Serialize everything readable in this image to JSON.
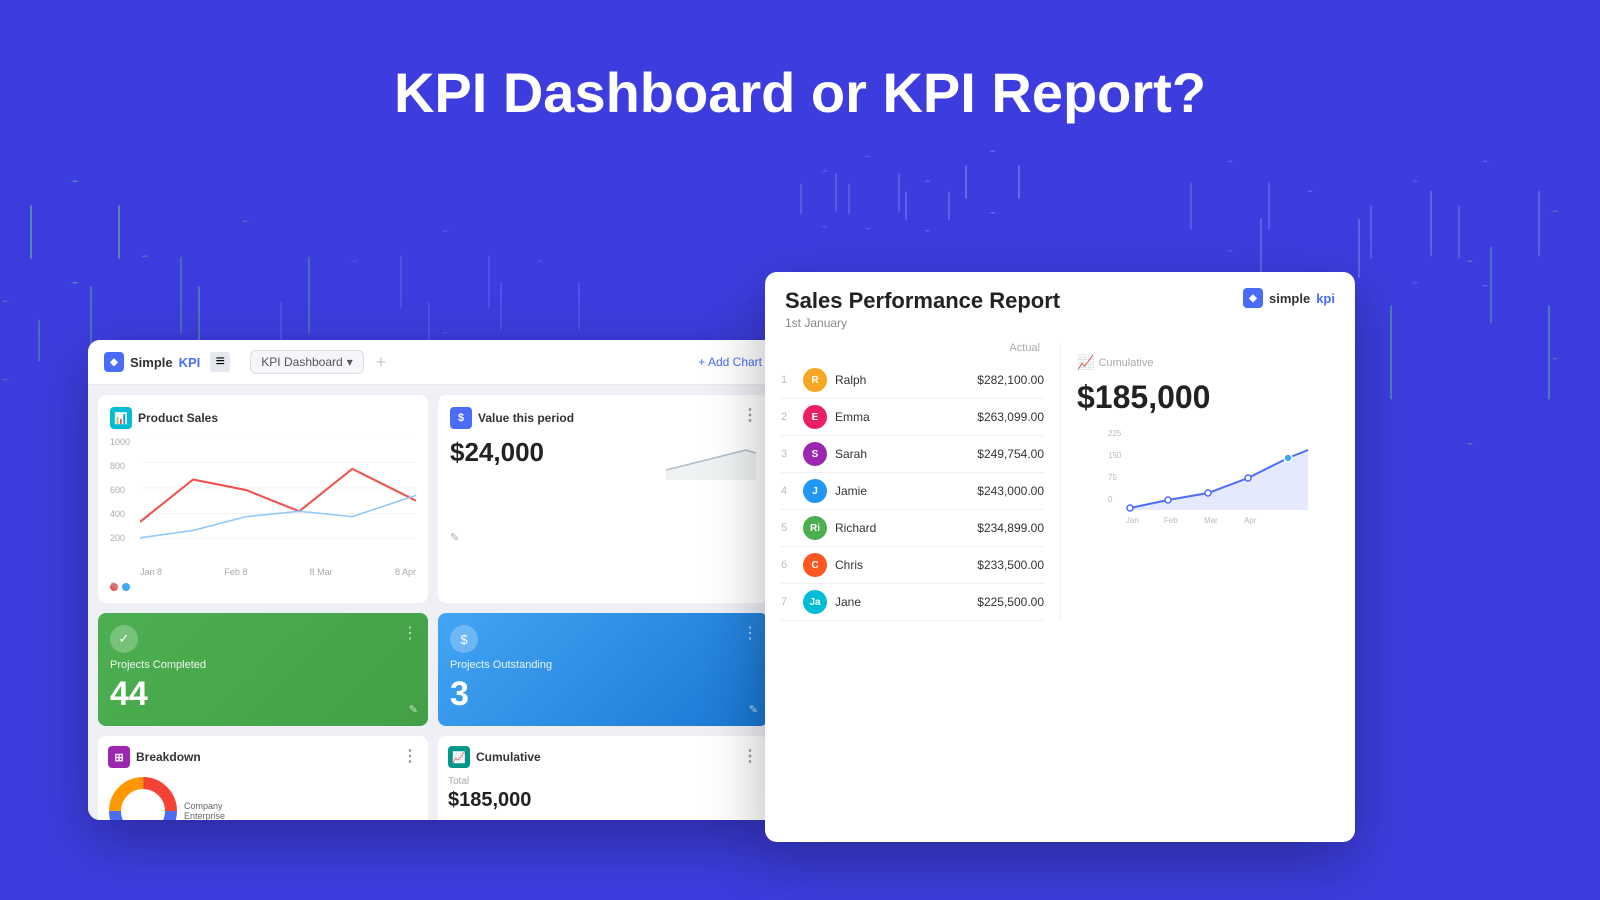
{
  "page": {
    "title": "KPI Dashboard or KPI Report?",
    "bg_color": "#3d3ddf"
  },
  "dashboard": {
    "logo_text": "Simple",
    "logo_blue": "KPI",
    "selector_label": "KPI Dashboard",
    "add_chart_label": "+ Add Chart",
    "product_sales": {
      "title": "Product Sales",
      "y_labels": [
        "1000",
        "800",
        "600",
        "400",
        "200",
        ""
      ],
      "x_labels": [
        "Jan 8",
        "Feb 8",
        "8 Mar",
        "8 Apr"
      ],
      "edit_icon": "✎"
    },
    "value_period": {
      "label": "Value this period",
      "value": "$24,000",
      "edit_icon": "✎"
    },
    "projects_completed": {
      "label": "Projects Completed",
      "value": "44",
      "icon": "✓"
    },
    "projects_outstanding": {
      "label": "Projects Outstanding",
      "value": "3",
      "icon": "$"
    },
    "breakdown": {
      "title": "Breakdown",
      "company_label": "Company",
      "enterprise_label": "Enterprise"
    },
    "cumulative": {
      "title": "Cumulative",
      "total_label": "Total",
      "total_value": "$185,000"
    }
  },
  "report": {
    "logo_text": "simple",
    "logo_blue": "kpi",
    "title": "Sales Performance Report",
    "date": "1st January",
    "actual_label": "Actual",
    "cumulative_label": "Cumulative",
    "cumulative_value": "$185,000",
    "chart_x_labels": [
      "Jan",
      "Feb",
      "Mar",
      "Apr"
    ],
    "rows": [
      {
        "rank": "1",
        "name": "Ralph",
        "value": "$282,100.00",
        "avatar": "R"
      },
      {
        "rank": "2",
        "name": "Emma",
        "value": "$263,099.00",
        "avatar": "E"
      },
      {
        "rank": "3",
        "name": "Sarah",
        "value": "$249,754.00",
        "avatar": "S"
      },
      {
        "rank": "4",
        "name": "Jamie",
        "value": "$243,000.00",
        "avatar": "J"
      },
      {
        "rank": "5",
        "name": "Richard",
        "value": "$234,899.00",
        "avatar": "Ri"
      },
      {
        "rank": "6",
        "name": "Chris",
        "value": "$233,500.00",
        "avatar": "C"
      },
      {
        "rank": "7",
        "name": "Jane",
        "value": "$225,500.00",
        "avatar": "Ja"
      }
    ]
  }
}
